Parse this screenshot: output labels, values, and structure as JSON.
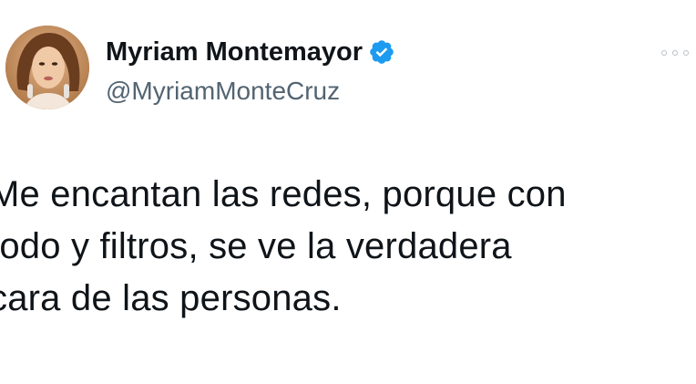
{
  "tweet": {
    "author": {
      "display_name": "Myriam Montemayor",
      "handle": "@MyriamMonteCruz",
      "avatar_icon": "profile-photo",
      "verified_icon": "verified-badge-icon",
      "verified_color": "#1d9bf0"
    },
    "more_icon": "more-options-icon",
    "text_lines": [
      "Me encantan las redes, porque con",
      "todo y filtros, se ve la verdadera",
      "cara de las personas."
    ]
  }
}
